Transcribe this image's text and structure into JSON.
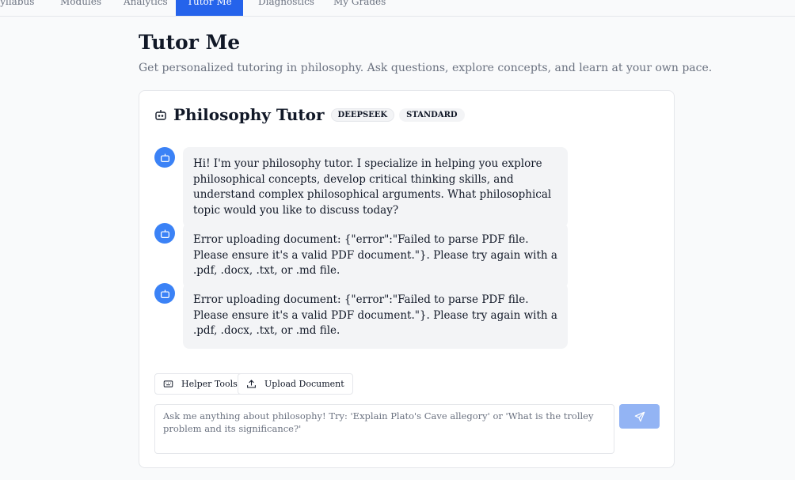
{
  "nav": {
    "tabs": [
      {
        "label": "Syllabus"
      },
      {
        "label": "Modules"
      },
      {
        "label": "Analytics"
      },
      {
        "label": "Tutor Me"
      },
      {
        "label": "Diagnostics"
      },
      {
        "label": "My Grades"
      }
    ],
    "active": "Tutor Me"
  },
  "header": {
    "title": "Tutor Me",
    "subtitle": "Get personalized tutoring in philosophy. Ask questions, explore concepts, and learn at your own pace."
  },
  "tutor": {
    "title": "Philosophy Tutor",
    "title_icon": "bot-icon",
    "badges": [
      "DEEPSEEK",
      "STANDARD"
    ]
  },
  "messages": [
    {
      "role": "assistant",
      "icon": "bot-icon",
      "text": "Hi! I'm your philosophy tutor. I specialize in helping you explore philosophical concepts, develop critical thinking skills, and understand complex philosophical arguments. What philosophical topic would you like to discuss today?"
    },
    {
      "role": "assistant",
      "icon": "bot-icon",
      "text": "Error uploading document: {\"error\":\"Failed to parse PDF file. Please ensure it's a valid PDF document.\"}. Please try again with a .pdf, .docx, .txt, or .md file."
    },
    {
      "role": "assistant",
      "icon": "bot-icon",
      "text": "Error uploading document: {\"error\":\"Failed to parse PDF file. Please ensure it's a valid PDF document.\"}. Please try again with a .pdf, .docx, .txt, or .md file."
    }
  ],
  "tools": {
    "helper_label": "Helper Tools",
    "helper_icon": "keyboard-icon",
    "upload_label": "Upload Document",
    "upload_icon": "upload-icon"
  },
  "composer": {
    "value": "",
    "placeholder": "Ask me anything about philosophy! Try: 'Explain Plato's Cave allegory' or 'What is the trolley problem and its significance?'",
    "send_icon": "send-icon"
  },
  "colors": {
    "accent": "#2563eb",
    "avatar": "#3b82f6",
    "send_disabled": "#93b4f4",
    "bubble": "#f3f4f6"
  }
}
